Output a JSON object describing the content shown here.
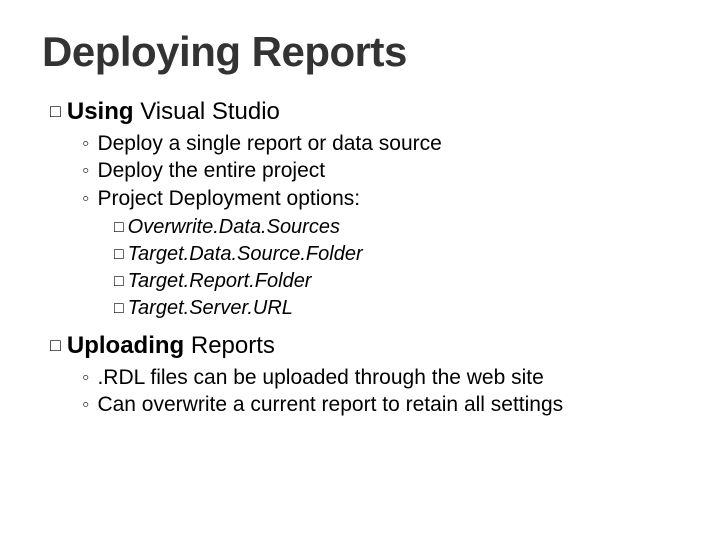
{
  "title": "Deploying Reports",
  "sections": [
    {
      "lead": "Using",
      "rest": "Visual Studio",
      "bullets": [
        "Deploy a single report or data source",
        "Deploy the entire project",
        "Project Deployment options:"
      ],
      "options": [
        "Overwrite.Data.Sources",
        "Target.Data.Source.Folder",
        "Target.Report.Folder",
        "Target.Server.URL"
      ]
    },
    {
      "lead": "Uploading",
      "rest": "Reports",
      "bullets": [
        ".RDL files can be uploaded through the web site",
        "Can overwrite a current report to retain all settings"
      ],
      "options": []
    }
  ],
  "glyphs": {
    "square": "□",
    "ring": "◦"
  }
}
